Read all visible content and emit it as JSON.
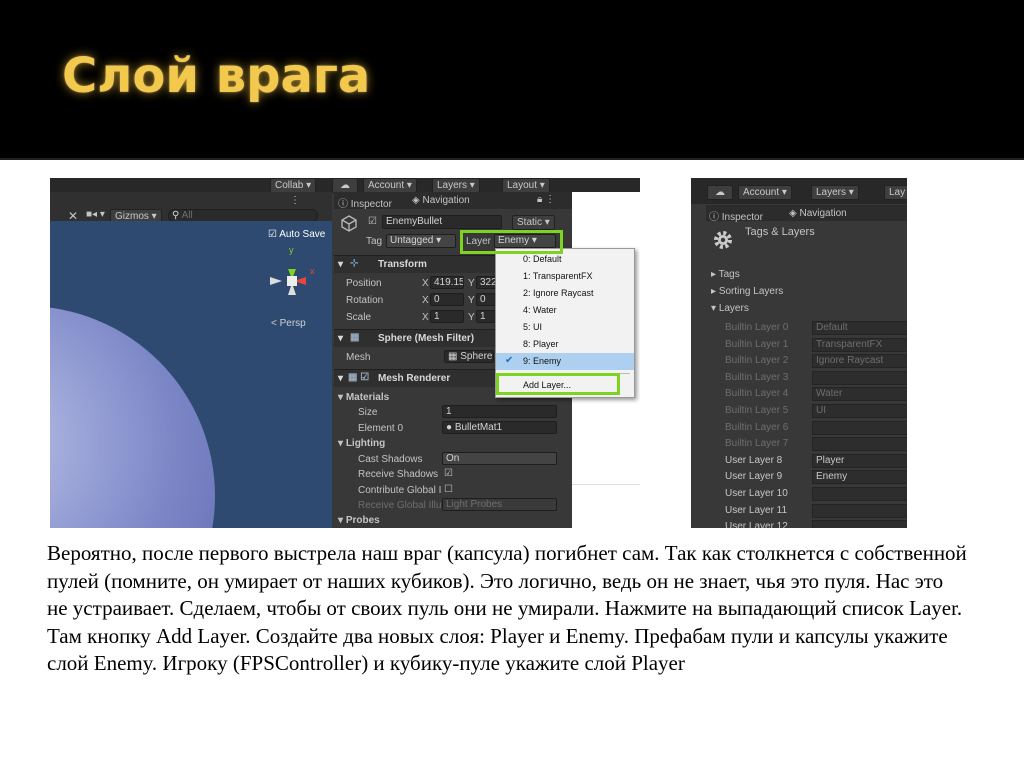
{
  "slide": {
    "title": "Слой врага",
    "body": "Вероятно, после первого выстрела наш враг (капсула) погибнет сам. Так как столкнется с собственной пулей (помните, он умирает от наших кубиков). Это логично, ведь он не знает, чья это пуля. Нас это не устраивает. Сделаем, чтобы от своих пуль они не умирали. Нажмите на выпадающий список Layer. Там кнопку Add Layer. Создайте два новых слоя: Player и Enemy. Префабам пули и капсулы укажите слой Enemy. Игроку (FPSController) и кубику-пуле укажите слой Player"
  },
  "left": {
    "toolbar": {
      "collab": "Collab ▾",
      "account": "Account ▾",
      "layers": "Layers ▾",
      "layout": "Layout ▾"
    },
    "scene": {
      "gizmos": "Gizmos ▾",
      "search_placeholder": "All",
      "auto_save": "Auto Save",
      "persp": "< Persp",
      "axis_y": "y",
      "axis_x": "x"
    },
    "tabs": {
      "inspector": "Inspector",
      "navigation": "Navigation"
    },
    "object": {
      "name": "EnemyBullet",
      "static": "Static ▾",
      "tag_label": "Tag",
      "tag_value": "Untagged",
      "layer_label": "Layer",
      "layer_value": "Enemy"
    },
    "transform": {
      "header": "Transform",
      "position": "Position",
      "rotation": "Rotation",
      "scale": "Scale",
      "pos_x": "419.15",
      "pos_y": "322",
      "rot_x": "0",
      "rot_y": "0",
      "scl_x": "1",
      "scl_y": "1",
      "x": "X",
      "y": "Y"
    },
    "mesh_filter": {
      "header": "Sphere (Mesh Filter)",
      "mesh_label": "Mesh",
      "mesh_value": "Sphere"
    },
    "renderer": {
      "header": "Mesh Renderer",
      "materials": "Materials",
      "size_label": "Size",
      "size_value": "1",
      "element_label": "Element 0",
      "element_value": "BulletMat1",
      "lighting": "Lighting",
      "cast_label": "Cast Shadows",
      "cast_value": "On",
      "receive_label": "Receive Shadows",
      "contrib_label": "Contribute Global I",
      "recv_gi_label": "Receive Global Illu",
      "recv_gi_value": "Light Probes",
      "probes": "Probes"
    },
    "layer_menu": {
      "items": [
        "0: Default",
        "1: TransparentFX",
        "2: Ignore Raycast",
        "4: Water",
        "5: UI",
        "8: Player",
        "9: Enemy"
      ],
      "add": "Add Layer..."
    }
  },
  "right": {
    "toolbar": {
      "account": "Account ▾",
      "layers": "Layers ▾",
      "lay": "Lay"
    },
    "tabs": {
      "inspector": "Inspector",
      "navigation": "Navigation"
    },
    "title": "Tags & Layers",
    "sections": {
      "tags": "Tags",
      "sorting": "Sorting Layers",
      "layers": "Layers"
    },
    "layers": [
      {
        "name": "Builtin Layer 0",
        "value": "Default"
      },
      {
        "name": "Builtin Layer 1",
        "value": "TransparentFX"
      },
      {
        "name": "Builtin Layer 2",
        "value": "Ignore Raycast"
      },
      {
        "name": "Builtin Layer 3",
        "value": ""
      },
      {
        "name": "Builtin Layer 4",
        "value": "Water"
      },
      {
        "name": "Builtin Layer 5",
        "value": "UI"
      },
      {
        "name": "Builtin Layer 6",
        "value": ""
      },
      {
        "name": "Builtin Layer 7",
        "value": ""
      },
      {
        "name": "User Layer 8",
        "value": "Player"
      },
      {
        "name": "User Layer 9",
        "value": "Enemy"
      },
      {
        "name": "User Layer 10",
        "value": ""
      },
      {
        "name": "User Layer 11",
        "value": ""
      },
      {
        "name": "User Layer 12",
        "value": ""
      }
    ]
  },
  "colors": {
    "title": "#f2c94c",
    "highlight": "#7ed321",
    "selection": "#aed0f0"
  }
}
